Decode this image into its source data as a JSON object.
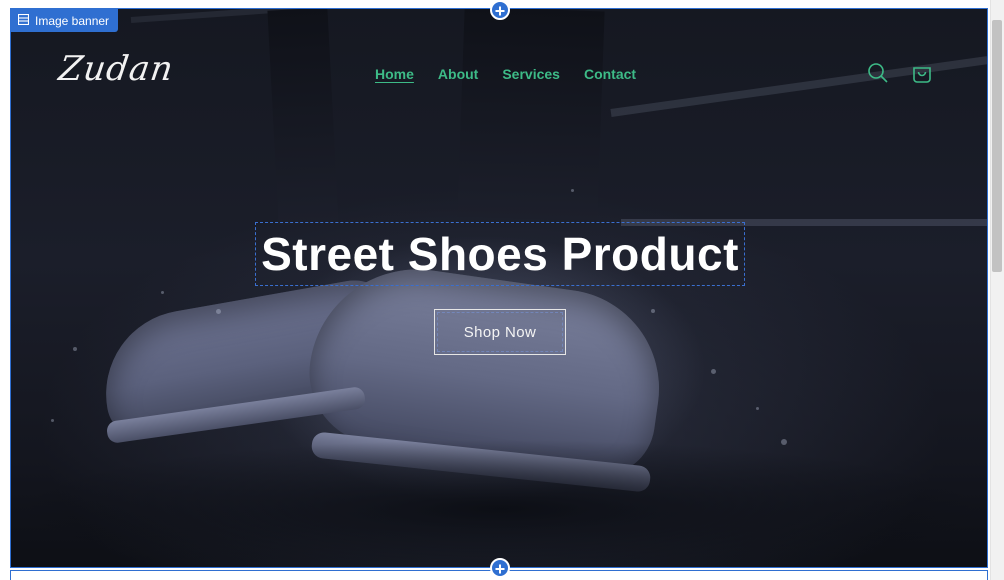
{
  "editor": {
    "section_tag_label": "Image banner",
    "add_section_symbol": "+"
  },
  "header": {
    "logo_text": "Zudan",
    "nav": [
      {
        "label": "Home",
        "active": true
      },
      {
        "label": "About",
        "active": false
      },
      {
        "label": "Services",
        "active": false
      },
      {
        "label": "Contact",
        "active": false
      }
    ],
    "icons": [
      "search-icon",
      "cart-icon"
    ]
  },
  "hero": {
    "title": "Street Shoes Product",
    "button_label": "Shop Now"
  },
  "colors": {
    "accent": "#3dbb87",
    "editor_blue": "#2f6fd1",
    "hero_text": "#ffffff"
  }
}
